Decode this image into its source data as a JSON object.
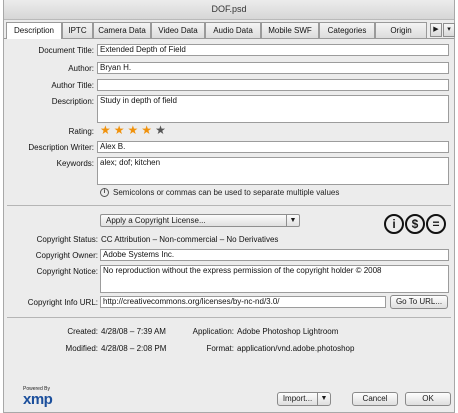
{
  "window": {
    "title": "DOF.psd"
  },
  "tabs": [
    {
      "label": "Description"
    },
    {
      "label": "IPTC"
    },
    {
      "label": "Camera Data"
    },
    {
      "label": "Video Data"
    },
    {
      "label": "Audio Data"
    },
    {
      "label": "Mobile SWF"
    },
    {
      "label": "Categories"
    },
    {
      "label": "Origin"
    }
  ],
  "tab_nav": {
    "next": "▶",
    "menu": "▾"
  },
  "description": {
    "document_title_label": "Document Title:",
    "document_title_value": "Extended Depth of Field",
    "author_label": "Author:",
    "author_value": "Bryan H.",
    "author_title_label": "Author Title:",
    "author_title_value": "",
    "description_label": "Description:",
    "description_value": "Study in depth of field",
    "rating_label": "Rating:",
    "rating": 4,
    "rating_max": 5,
    "description_writer_label": "Description Writer:",
    "description_writer_value": "Alex B.",
    "keywords_label": "Keywords:",
    "keywords_value": "alex; dof; kitchen",
    "keywords_hint": "Semicolons or commas can be used to separate multiple values"
  },
  "copyright": {
    "license_select": "Apply a Copyright License...",
    "status_label": "Copyright Status:",
    "status_value": "CC Attribution – Non-commercial – No Derivatives",
    "owner_label": "Copyright Owner:",
    "owner_value": "Adobe Systems Inc.",
    "notice_label": "Copyright Notice:",
    "notice_value": "No reproduction without the express permission of the copyright holder © 2008",
    "info_url_label": "Copyright Info URL:",
    "info_url_value": "http://creativecommons.org/licenses/by-nc-nd/3.0/",
    "go_to_url": "Go To URL..."
  },
  "metadata": {
    "created_label": "Created:",
    "created_value": "4/28/08 – 7:39 AM",
    "modified_label": "Modified:",
    "modified_value": "4/28/08 – 2:08 PM",
    "application_label": "Application:",
    "application_value": "Adobe Photoshop Lightroom",
    "format_label": "Format:",
    "format_value": "application/vnd.adobe.photoshop"
  },
  "footer": {
    "powered_by": "Powered By",
    "xmp": "xmp",
    "import_label": "Import...",
    "cancel_label": "Cancel",
    "ok_label": "OK"
  },
  "colors": {
    "star_on": "#f0920c",
    "star_off": "#555555",
    "xmp_blue": "#1b4f9c"
  }
}
